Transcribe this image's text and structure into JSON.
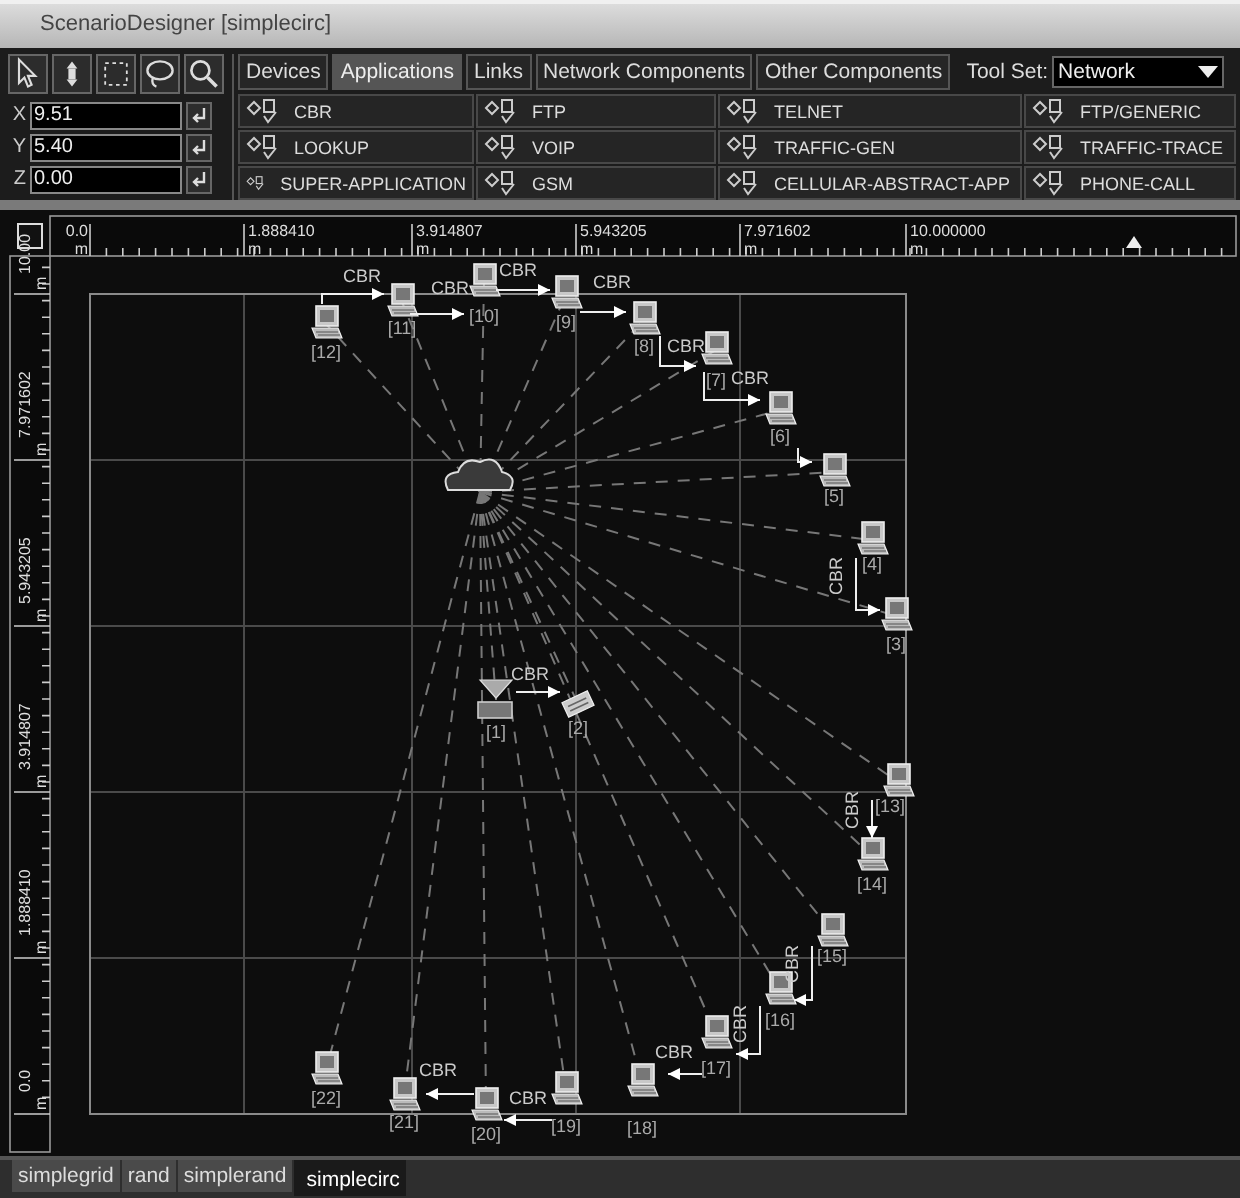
{
  "window": {
    "title": "ScenarioDesigner [simplecirc]"
  },
  "coordinates": [
    {
      "axis": "X",
      "value": "9.51"
    },
    {
      "axis": "Y",
      "value": "5.40"
    },
    {
      "axis": "Z",
      "value": "0.00"
    }
  ],
  "component_tabs": [
    {
      "label": "Devices",
      "selected": false
    },
    {
      "label": "Applications",
      "selected": true
    },
    {
      "label": "Links",
      "selected": false
    },
    {
      "label": "Network Components",
      "selected": false
    },
    {
      "label": "Other Components",
      "selected": false
    }
  ],
  "tool_set": {
    "label": "Tool Set:",
    "value": "Network"
  },
  "applications": [
    "CBR",
    "FTP",
    "TELNET",
    "FTP/GENERIC",
    "LOOKUP",
    "VOIP",
    "TRAFFIC-GEN",
    "TRAFFIC-TRACE",
    "SUPER-APPLICATION",
    "GSM",
    "CELLULAR-ABSTRACT-APP",
    "PHONE-CALL"
  ],
  "ruler": {
    "x_ticks": [
      {
        "label": "0.0",
        "unit": "m"
      },
      {
        "label": "1.888410",
        "unit": "m"
      },
      {
        "label": "3.914807",
        "unit": "m"
      },
      {
        "label": "5.943205",
        "unit": "m"
      },
      {
        "label": "7.971602",
        "unit": "m"
      },
      {
        "label": "10.000000",
        "unit": "m"
      }
    ],
    "y_ticks": [
      {
        "label": "10.00",
        "unit": "m"
      },
      {
        "label": "7.971602",
        "unit": "m"
      },
      {
        "label": "5.943205",
        "unit": "m"
      },
      {
        "label": "3.914807",
        "unit": "m"
      },
      {
        "label": "1.888410",
        "unit": "m"
      },
      {
        "label": "0.0",
        "unit": "m"
      }
    ]
  },
  "scenario": {
    "nodes": [
      {
        "label": "[1]",
        "kind": "antenna"
      },
      {
        "label": "[2]",
        "kind": "device"
      },
      {
        "label": "[3]",
        "kind": "computer"
      },
      {
        "label": "[4]",
        "kind": "computer"
      },
      {
        "label": "[5]",
        "kind": "computer"
      },
      {
        "label": "[6]",
        "kind": "computer"
      },
      {
        "label": "[7]",
        "kind": "computer"
      },
      {
        "label": "[12]",
        "kind": "computer"
      },
      {
        "label": "[11]",
        "kind": "computer"
      },
      {
        "label": "[10]",
        "kind": "computer"
      },
      {
        "label": "[9]",
        "kind": "computer"
      },
      {
        "label": "[8]",
        "kind": "computer"
      },
      {
        "label": "[13]",
        "kind": "computer"
      },
      {
        "label": "[14]",
        "kind": "computer"
      },
      {
        "label": "[15]",
        "kind": "computer"
      },
      {
        "label": "[16]",
        "kind": "computer"
      },
      {
        "label": "[17]",
        "kind": "computer"
      },
      {
        "label": "[22]",
        "kind": "computer"
      },
      {
        "label": "[21]",
        "kind": "computer"
      },
      {
        "label": "[20]",
        "kind": "computer"
      },
      {
        "label": "[19]",
        "kind": "computer"
      },
      {
        "label": "[18]",
        "kind": "computer"
      },
      {
        "kind": "cloud"
      }
    ],
    "links": [
      {
        "label": "CBR"
      },
      {
        "label": "CBR"
      },
      {
        "label": "CBR"
      },
      {
        "label": "CBR"
      },
      {
        "label": "CBR"
      },
      {
        "label": "CBR"
      },
      {
        "label": "CBR"
      },
      {
        "label": "CBR"
      },
      {
        "label": "CBR"
      },
      {
        "label": "CBR"
      },
      {
        "label": "CBR"
      },
      {
        "label": "CBR"
      },
      {
        "label": "CBR"
      },
      {
        "label": "CBR"
      }
    ]
  },
  "scenario_tabs": [
    {
      "label": "simplegrid",
      "selected": false
    },
    {
      "label": "rand",
      "selected": false
    },
    {
      "label": "simplerand",
      "selected": false
    },
    {
      "label": "simplecirc",
      "selected": true
    }
  ]
}
